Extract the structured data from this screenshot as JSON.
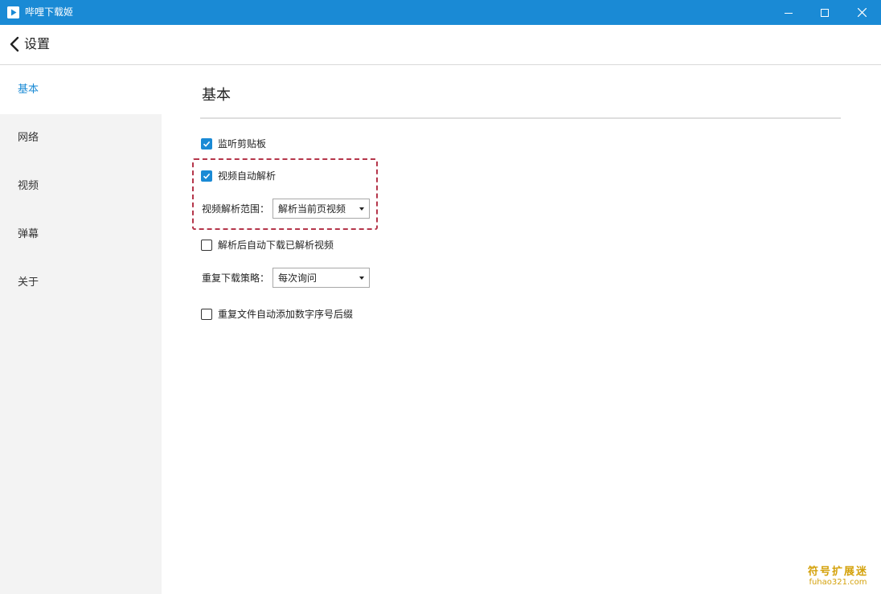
{
  "window": {
    "title": "哔哩下载姬"
  },
  "header": {
    "back_label": "设置"
  },
  "sidebar": {
    "items": [
      {
        "label": "基本",
        "active": true
      },
      {
        "label": "网络"
      },
      {
        "label": "视频"
      },
      {
        "label": "弹幕"
      },
      {
        "label": "关于"
      }
    ]
  },
  "main": {
    "section_title": "基本",
    "options": {
      "monitor_clipboard": {
        "label": "监听剪贴板",
        "checked": true
      },
      "auto_parse_video": {
        "label": "视频自动解析",
        "checked": true
      },
      "parse_range": {
        "label": "视频解析范围：",
        "value": "解析当前页视频"
      },
      "auto_download_after_parse": {
        "label": "解析后自动下载已解析视频",
        "checked": false
      },
      "duplicate_policy": {
        "label": "重复下载策略：",
        "value": "每次询问"
      },
      "add_number_suffix": {
        "label": "重复文件自动添加数字序号后缀",
        "checked": false
      }
    }
  },
  "watermark": {
    "top": "符号扩展迷",
    "bottom": "fuhao321.com"
  },
  "colors": {
    "accent": "#1a8ad5",
    "highlight_border": "#b5364b"
  }
}
